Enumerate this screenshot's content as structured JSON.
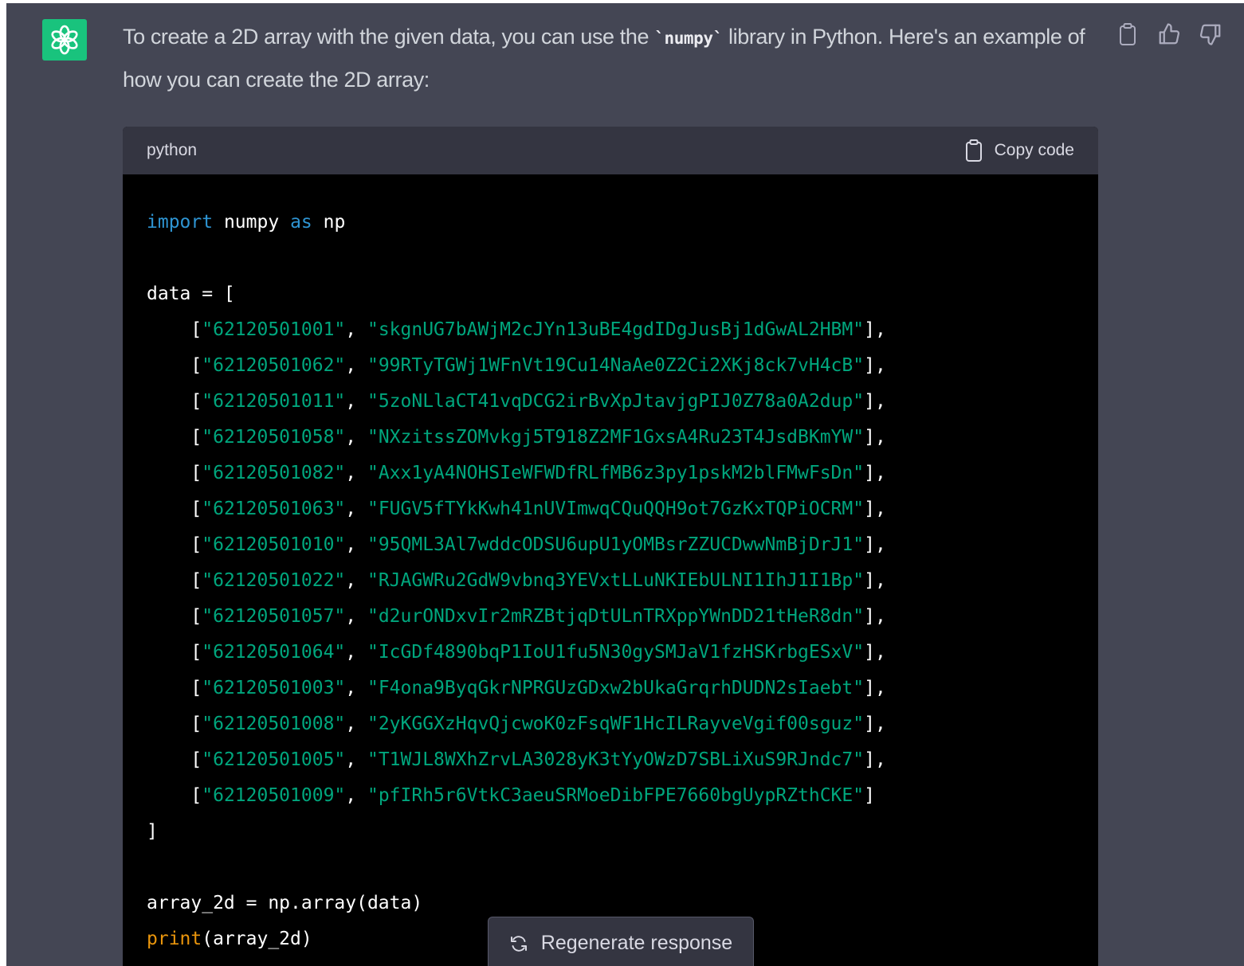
{
  "message": {
    "text_before": "To create a 2D array with the given data, you can use the ",
    "inline_code": "`numpy`",
    "text_after": " library in Python. Here's an example of how you can create the 2D array:"
  },
  "icons": {
    "avatar": "openai-logo-icon",
    "copy": "clipboard-icon",
    "thumbs_up": "thumbs-up-icon",
    "thumbs_down": "thumbs-down-icon",
    "regenerate": "refresh-icon"
  },
  "code_block": {
    "language": "python",
    "copy_label": "Copy code",
    "import_kw": "import",
    "import_mod": "numpy",
    "as_kw": "as",
    "alias": "np",
    "data_open": "data = [",
    "rows": [
      [
        "62120501001",
        "skgnUG7bAWjM2cJYn13uBE4gdIDgJusBj1dGwAL2HBM"
      ],
      [
        "62120501062",
        "99RTyTGWj1WFnVt19Cu14NaAe0Z2Ci2XKj8ck7vH4cB"
      ],
      [
        "62120501011",
        "5zoNLlaCT41vqDCG2irBvXpJtavjgPIJ0Z78a0A2dup"
      ],
      [
        "62120501058",
        "NXzitssZOMvkgj5T918Z2MF1GxsA4Ru23T4JsdBKmYW"
      ],
      [
        "62120501082",
        "Axx1yA4NOHSIeWFWDfRLfMB6z3py1pskM2blFMwFsDn"
      ],
      [
        "62120501063",
        "FUGV5fTYkKwh41nUVImwqCQuQQH9ot7GzKxTQPiOCRM"
      ],
      [
        "62120501010",
        "95QML3Al7wddcODSU6upU1yOMBsrZZUCDwwNmBjDrJ1"
      ],
      [
        "62120501022",
        "RJAGWRu2GdW9vbnq3YEVxtLLuNKIEbULNI1IhJ1I1Bp"
      ],
      [
        "62120501057",
        "d2urONDxvIr2mRZBtjqDtULnTRXppYWnDD21tHeR8dn"
      ],
      [
        "62120501064",
        "IcGDf4890bqP1IoU1fu5N30gySMJaV1fzHSKrbgESxV"
      ],
      [
        "62120501003",
        "F4ona9ByqGkrNPRGUzGDxw2bUkaGrqrhDUDN2sIaebt"
      ],
      [
        "62120501008",
        "2yKGGXzHqvQjcwoK0zFsqWF1HcILRayveVgif00sguz"
      ],
      [
        "62120501005",
        "T1WJL8WXhZrvLA3028yK3tYyOWzD7SBLiXuS9RJndc7"
      ],
      [
        "62120501009",
        "pfIRh5r6VtkC3aeuSRMoeDibFPE7660bgUypRZthCKE"
      ]
    ],
    "data_close": "]",
    "array_line": "array_2d = np.array(data)",
    "print_fn": "print",
    "print_args": "(array_2d)"
  },
  "regenerate_label": "Regenerate response"
}
